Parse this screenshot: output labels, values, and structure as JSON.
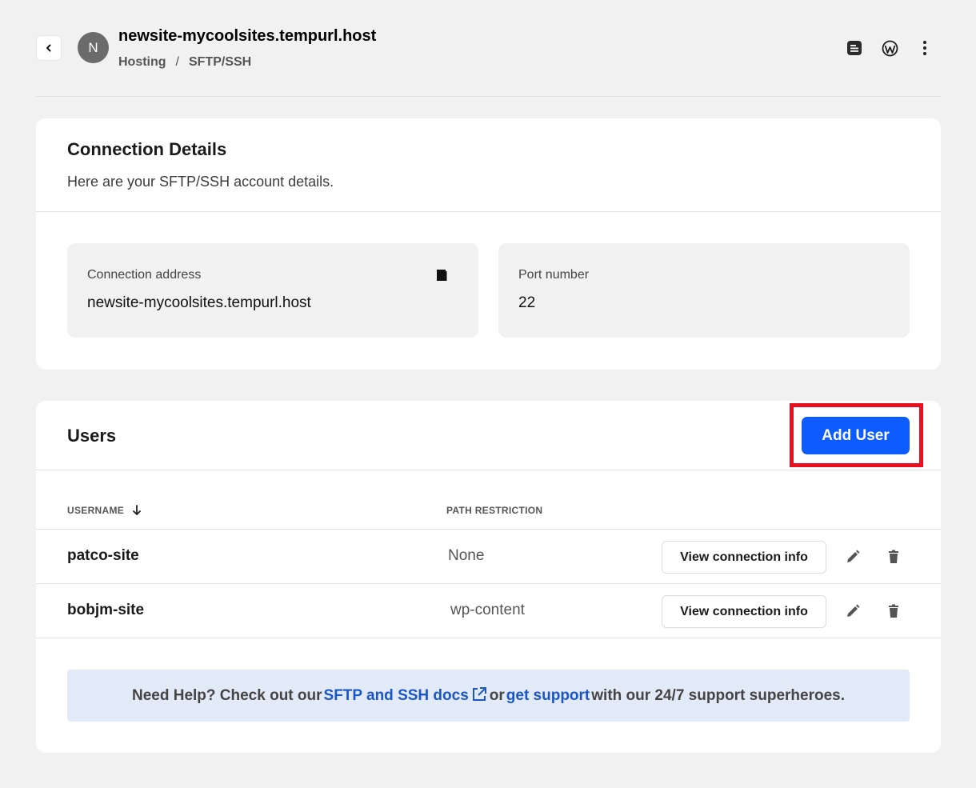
{
  "header": {
    "avatar_letter": "N",
    "site_title": "newsite-mycoolsites.tempurl.host",
    "breadcrumb": [
      "Hosting",
      "SFTP/SSH"
    ],
    "breadcrumb_separator": "/",
    "icons": [
      "document-icon",
      "wordpress-icon",
      "more-vertical-icon"
    ]
  },
  "connection": {
    "title": "Connection Details",
    "subtitle": "Here are your SFTP/SSH account details.",
    "address_label": "Connection address",
    "address_value": "newsite-mycoolsites.tempurl.host",
    "port_label": "Port number",
    "port_value": "22"
  },
  "users": {
    "title": "Users",
    "add_button": "Add User",
    "col_username": "USERNAME",
    "col_path": "PATH RESTRICTION",
    "rows": [
      {
        "username": "patco-site",
        "path": "None",
        "action": "View connection info"
      },
      {
        "username": "bobjm-site",
        "path": "wp-content",
        "action": "View connection info"
      }
    ]
  },
  "help": {
    "prefix": "Need Help? Check out our",
    "docs_link": "SFTP and SSH docs",
    "middle": "or",
    "support_link": "get support",
    "suffix": "with our 24/7 support superheroes."
  },
  "colors": {
    "accent": "#0d5cff",
    "highlight": "#e8101e",
    "link": "#1a56c9",
    "help_bg": "#e2eaf8"
  }
}
